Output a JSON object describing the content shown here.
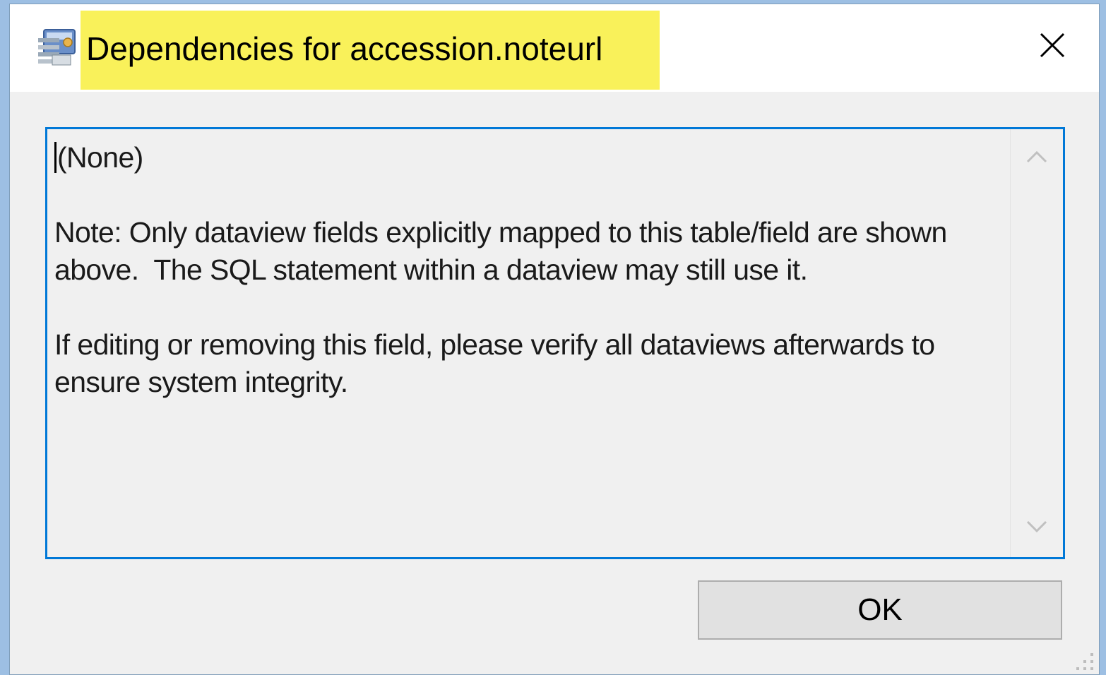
{
  "window": {
    "title": "Dependencies for accession.noteurl",
    "title_highlight_color": "#f9f15a",
    "close_icon": "close-icon",
    "app_icon": "database-app-icon"
  },
  "textbox": {
    "first_line": "(None)",
    "note_line": "Note: Only dataview fields explicitly mapped to this table/field are shown above.  The SQL statement within a dataview may still use it.",
    "warning_line": "If editing or removing this field, please verify all dataviews afterwards to ensure system integrity.",
    "border_color": "#0078d7"
  },
  "buttons": {
    "ok_label": "OK"
  }
}
